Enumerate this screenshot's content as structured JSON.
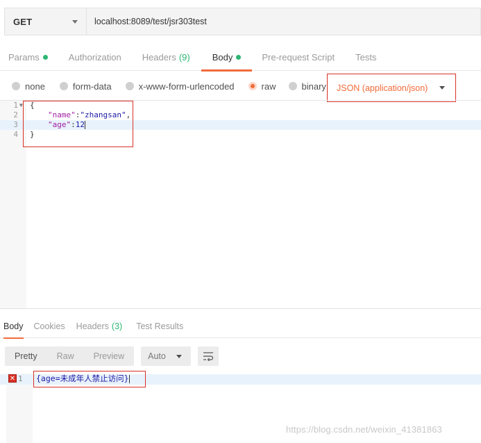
{
  "request": {
    "method": "GET",
    "url": "localhost:8089/test/jsr303test"
  },
  "request_tabs": [
    {
      "label": "Params",
      "dot": true
    },
    {
      "label": "Authorization"
    },
    {
      "label": "Headers",
      "count": "(9)"
    },
    {
      "label": "Body",
      "dot": true,
      "active": true
    },
    {
      "label": "Pre-request Script"
    },
    {
      "label": "Tests"
    }
  ],
  "body_modes": {
    "options": [
      "none",
      "form-data",
      "x-www-form-urlencoded",
      "raw",
      "binary"
    ],
    "selected": "raw",
    "raw_type": "JSON (application/json)"
  },
  "editor": {
    "lines": [
      {
        "num": "1",
        "text": "{"
      },
      {
        "num": "2",
        "key": "\"name\"",
        "value": "\"zhangsan\"",
        "suffix": ","
      },
      {
        "num": "3",
        "key": "\"age\"",
        "value": "12"
      },
      {
        "num": "4",
        "text": "}"
      }
    ]
  },
  "response_tabs": [
    {
      "label": "Body",
      "active": true
    },
    {
      "label": "Cookies"
    },
    {
      "label": "Headers",
      "count": "(3)"
    },
    {
      "label": "Test Results"
    }
  ],
  "response_toolbar": {
    "formats": [
      "Pretty",
      "Raw",
      "Preview"
    ],
    "selected_format": "Pretty",
    "language": "Auto"
  },
  "response": {
    "line_num": "1",
    "text": "{age=未成年人禁止访问}"
  },
  "watermark": "https://blog.csdn.net/weixin_41381863",
  "colors": {
    "accent": "#f26b3a",
    "status_green": "#2bb673",
    "highlight_box": "#d93025"
  }
}
